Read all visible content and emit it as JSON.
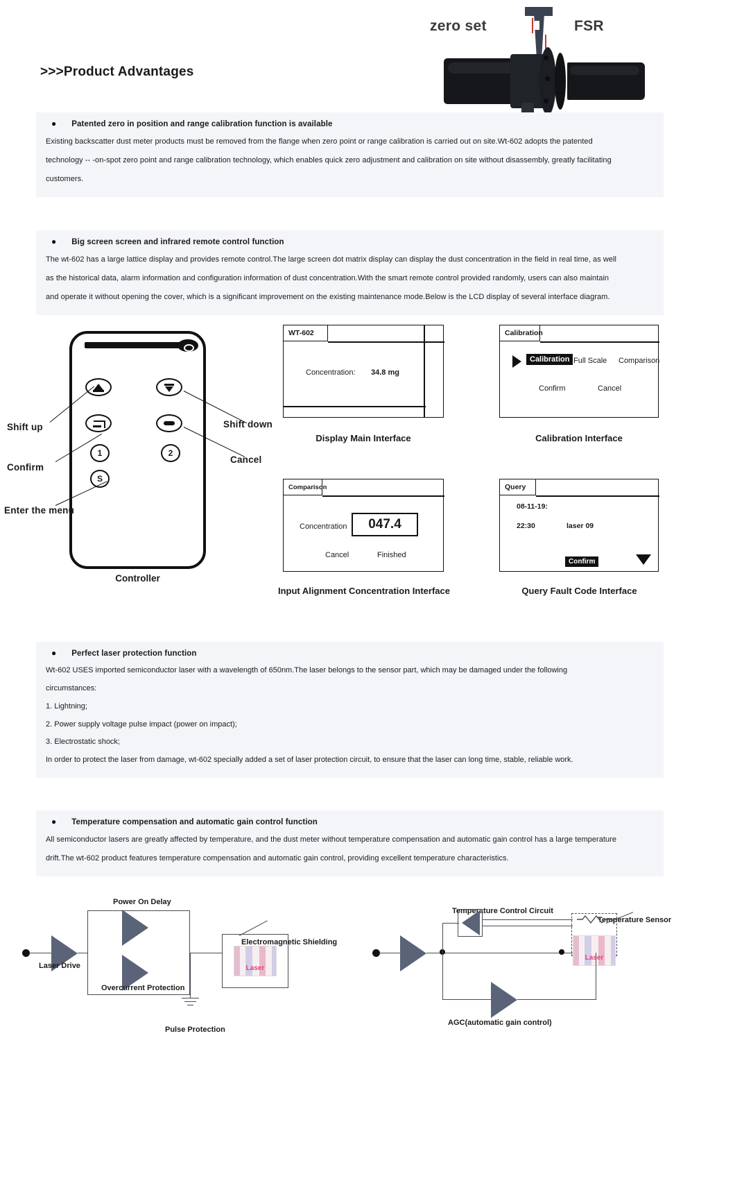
{
  "header": {
    "title": ">>>Product Advantages",
    "image_labels": {
      "left": "zero set",
      "right": "FSR"
    }
  },
  "sections": [
    {
      "bullet": "Patented zero in position and range calibration function is available",
      "paragraphs": [
        "Existing backscatter dust meter products must be removed from the flange when zero point or range calibration is carried out on site.Wt-602 adopts the patented",
        "technology -- -on-spot zero point and range calibration technology, which enables quick zero adjustment and calibration on site without disassembly, greatly facilitating",
        "customers."
      ]
    },
    {
      "bullet": "Big screen screen and infrared remote control function",
      "paragraphs": [
        "The wt-602 has a large lattice display and provides remote control.The large screen dot matrix display can display the dust concentration in the field in real time, as well",
        "as the historical data, alarm information and configuration information of dust concentration.With the smart remote control provided randomly, users can also maintain",
        "and operate it without opening the cover, which is a significant improvement on the existing maintenance mode.Below is the LCD display of several interface diagram."
      ]
    },
    {
      "bullet": "Perfect laser protection function",
      "paragraphs": [
        "Wt-602 USES imported semiconductor laser with a wavelength of 650nm.The laser belongs to the sensor part, which may be damaged under the following",
        "circumstances:",
        "1. Lightning;",
        "2. Power supply voltage pulse impact (power on impact);",
        "3. Electrostatic shock;",
        "In order to protect the laser from damage, wt-602 specially added a set of laser protection circuit, to ensure that the laser can long time, stable, reliable work."
      ]
    },
    {
      "bullet": "Temperature compensation and automatic gain control function",
      "paragraphs": [
        "All semiconductor lasers are greatly affected by temperature, and the dust meter without temperature compensation and automatic gain control has a large temperature",
        "drift.The wt-602 product features temperature compensation and automatic gain control, providing excellent temperature characteristics."
      ]
    }
  ],
  "remote": {
    "caption": "Controller",
    "callouts": {
      "shift_up": "Shift up",
      "shift_down": "Shift down",
      "confirm": "Confirm",
      "cancel": "Cancel",
      "enter_menu": "Enter the menu"
    },
    "buttons": [
      {
        "name": "shift-up",
        "glyph": "up-arrow-bar"
      },
      {
        "name": "shift-down",
        "glyph": "down-arrow-bar"
      },
      {
        "name": "confirm",
        "glyph": "return-arrow"
      },
      {
        "name": "cancel",
        "glyph": "dash"
      },
      {
        "name": "one",
        "glyph": "1"
      },
      {
        "name": "two",
        "glyph": "2"
      },
      {
        "name": "menu",
        "glyph": "S"
      }
    ]
  },
  "lcd_screens": {
    "main": {
      "tab": "WT-602",
      "label": "Concentration:",
      "value": "34.8 mg",
      "caption": "Display Main Interface"
    },
    "calibration": {
      "tab": "Calibration",
      "options": [
        "Calibration",
        "Full Scale",
        "Comparison"
      ],
      "selected": "Calibration",
      "actions": [
        "Confirm",
        "Cancel"
      ],
      "caption": "Calibration Interface"
    },
    "comparison": {
      "tab": "Comparison",
      "label": "Concentration",
      "value": "047.4",
      "actions": [
        "Cancel",
        "Finished"
      ],
      "caption": "Input Alignment Concentration Interface"
    },
    "query": {
      "tab": "Query",
      "date": "08-11-19:",
      "time": "22:30",
      "code": "laser 09",
      "action": "Confirm",
      "caption": "Query Fault Code Interface"
    }
  },
  "circuit_left": {
    "labels": {
      "power_on_delay": "Power On Delay",
      "laser_drive": "Laser Drive",
      "overcurrent": "Overcurrent Protection",
      "pulse": "Pulse Protection",
      "shielding": "Electromagnetic Shielding",
      "laser": "Laser"
    }
  },
  "circuit_right": {
    "labels": {
      "temp_control": "Temperature Control Circuit",
      "temp_sensor": "Temperature Sensor",
      "agc": "AGC(automatic gain control)",
      "laser": "Laser"
    }
  }
}
